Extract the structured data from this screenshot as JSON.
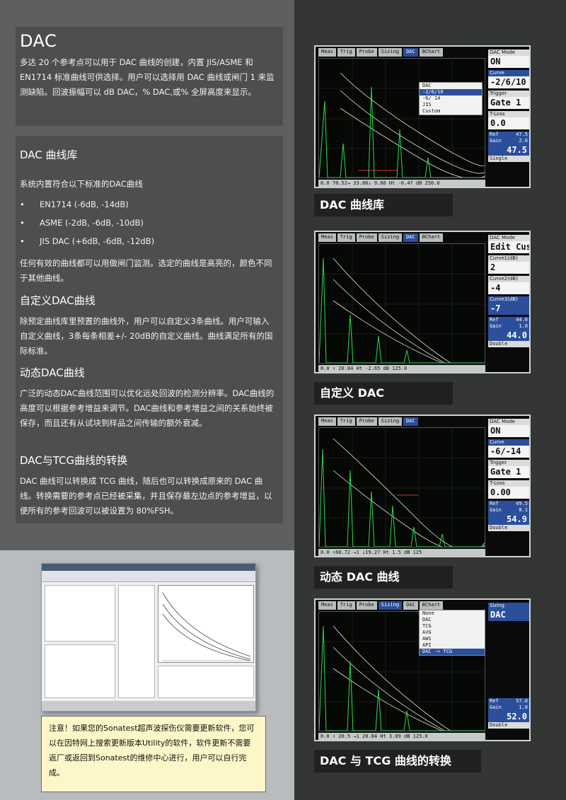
{
  "left": {
    "title": "DAC",
    "intro": "多达 20 个参考点可以用于 DAC 曲线的创建，内置 JIS/ASME 和 EN1714 标准曲线可供选择。用户可以选择用 DAC 曲线或闸门 1 来监测缺陷。回波振幅可以 dB DAC，% DAC,或% 全屏高度来显示。",
    "library_title": "DAC 曲线库",
    "library_intro": "系统内置符合以下标准的DAC曲线",
    "bullets": [
      "EN1714 (-6dB, -14dB)",
      "ASME (-2dB, -6dB, -10dB)",
      "JIS DAC (+6dB, -6dB, -12dB)"
    ],
    "bullet_mark": "•",
    "library_note": "任何有效的曲线都可以用做闸门监测。选定的曲线是高亮的，颜色不同于其他曲线。",
    "custom_title": "自定义DAC曲线",
    "custom_text": "除预定曲线库里预置的曲线外，用户可以自定义3条曲线。用户可输入自定义曲线，3条每条相差+/- 20dB的自定义曲线。曲线满足所有的国际标准。",
    "dynamic_title": "动态DAC曲线",
    "dynamic_text": "广泛的动态DAC曲线范围可以优化远处回波的检测分辨率。DAC曲线的高度可以根据参考增益来调节。DAC曲线和参考增益之间的关系始终被保存，而且还有从试块到样品之间传输的额外衰减。",
    "convert_title": "DAC与TCG曲线的转换",
    "convert_text": "DAC 曲线可以转换成 TCG 曲线，随后也可以转换成原来的 DAC 曲线。转换需要的参考点已经被采集，并且保存最左边点的参考增益，以便所有的参考回波可以被设置为 80%FSH。"
  },
  "note": "注意！如果您的Sonatest超声波探伤仪需要更新软件，您可以在因特网上搜索更新版本Utility的软件，软件更新不需要返厂或返回到Sonatest的维修中心进行，用户可以自行完成。",
  "screens": [
    {
      "caption": "DAC 曲线库",
      "tabs": [
        "Meas",
        "Trig",
        "Probe",
        "Sizing",
        "DAC",
        "BChart"
      ],
      "active_tab": 4,
      "menu": [
        "DAC",
        "-2/6/10",
        "-6/ 14",
        "JIS",
        "Custom"
      ],
      "menu_selected": 1,
      "status": "0.0  70.52→  33.86↓   9.86 Ht  -0.47 dB 250.0",
      "status_sub": "DAC",
      "side": {
        "mode_label": "DAC Mode",
        "mode_value": "ON",
        "curve_label": "Curve",
        "curve_value": "-2/6/10",
        "trigger_label": "Trigger",
        "trigger_value": "Gate 1",
        "tloss_label": "T-Loss",
        "tloss_unit": "dB",
        "tloss_value": "0.0",
        "ref_label": "Ref",
        "ref_value": "47.5",
        "gain_label": "Gain",
        "gain_step": "2.0",
        "gain_value": "47.5",
        "footer": "Single"
      }
    },
    {
      "caption": "自定义 DAC",
      "tabs": [
        "Meas",
        "Trig",
        "Probe",
        "Sizing",
        "DAC",
        "BChart"
      ],
      "active_tab": 4,
      "status": "0.0  ↑    20.84 Ht         -2.65 dB 125.0",
      "status_sub": "DAC",
      "side": {
        "mode_label": "DAC Mode",
        "mode_value": "Edit Cus",
        "c1_label": "Curve1(dB)",
        "c1_value": "2",
        "c2_label": "Curve2(dB)",
        "c2_value": "-4",
        "c3_label": "Curve3(dB)",
        "c3_value": "-7",
        "ref_label": "Ref",
        "ref_value": "44.0",
        "gain_label": "Gain",
        "gain_step": "1.0",
        "gain_value": "44.0",
        "footer": "Double"
      }
    },
    {
      "caption": "动态 DAC 曲线",
      "tabs": [
        "Meas",
        "Trig",
        "Probe",
        "Sizing",
        "DAC"
      ],
      "active_tab": 4,
      "status": "0.0 ↑60.72  →1     ↓19.27   Ht 1.5    dB  125",
      "status_sub": "DAC",
      "side": {
        "mode_label": "DAC Mode",
        "mode_value": "ON",
        "curve_label": "Curve",
        "curve_value": "-6/-14",
        "trigger_label": "Trigger",
        "trigger_value": "Gate 1",
        "tloss_label": "T-Loss",
        "tloss_unit": "dB",
        "tloss_value": "0.00",
        "ref_label": "Ref",
        "ref_value": "49.5",
        "gain_label": "Gain",
        "gain_step": "0.1",
        "gain_value": "54.9",
        "footer": "Double"
      }
    },
    {
      "caption": "DAC 与 TCG 曲线的转换",
      "tabs": [
        "Meas",
        "Trig",
        "Probe",
        "Sizing",
        "DAC",
        "BChart"
      ],
      "active_tab": 3,
      "menu": [
        "None",
        "DAC",
        "TCG",
        "AVG",
        "AWS",
        "API",
        "DAC -> TCG"
      ],
      "menu_selected": 6,
      "status": "0.0  ↑   20.5  →1     20.84 Ht  3.09 dB 125.0",
      "status_sub": "DAC",
      "side": {
        "sizing_label": "Sizing",
        "sizing_value": "DAC",
        "ref_label": "Ref",
        "ref_value": "57.0",
        "gain_label": "Gain",
        "gain_step": "1.0",
        "gain_value": "52.0",
        "footer": "Double"
      }
    }
  ],
  "colors": {
    "accent_blue": "#2c4f9c",
    "signal_green": "#2fd84a",
    "curve_white": "#e8e8d8",
    "gate_red": "#e03030"
  }
}
